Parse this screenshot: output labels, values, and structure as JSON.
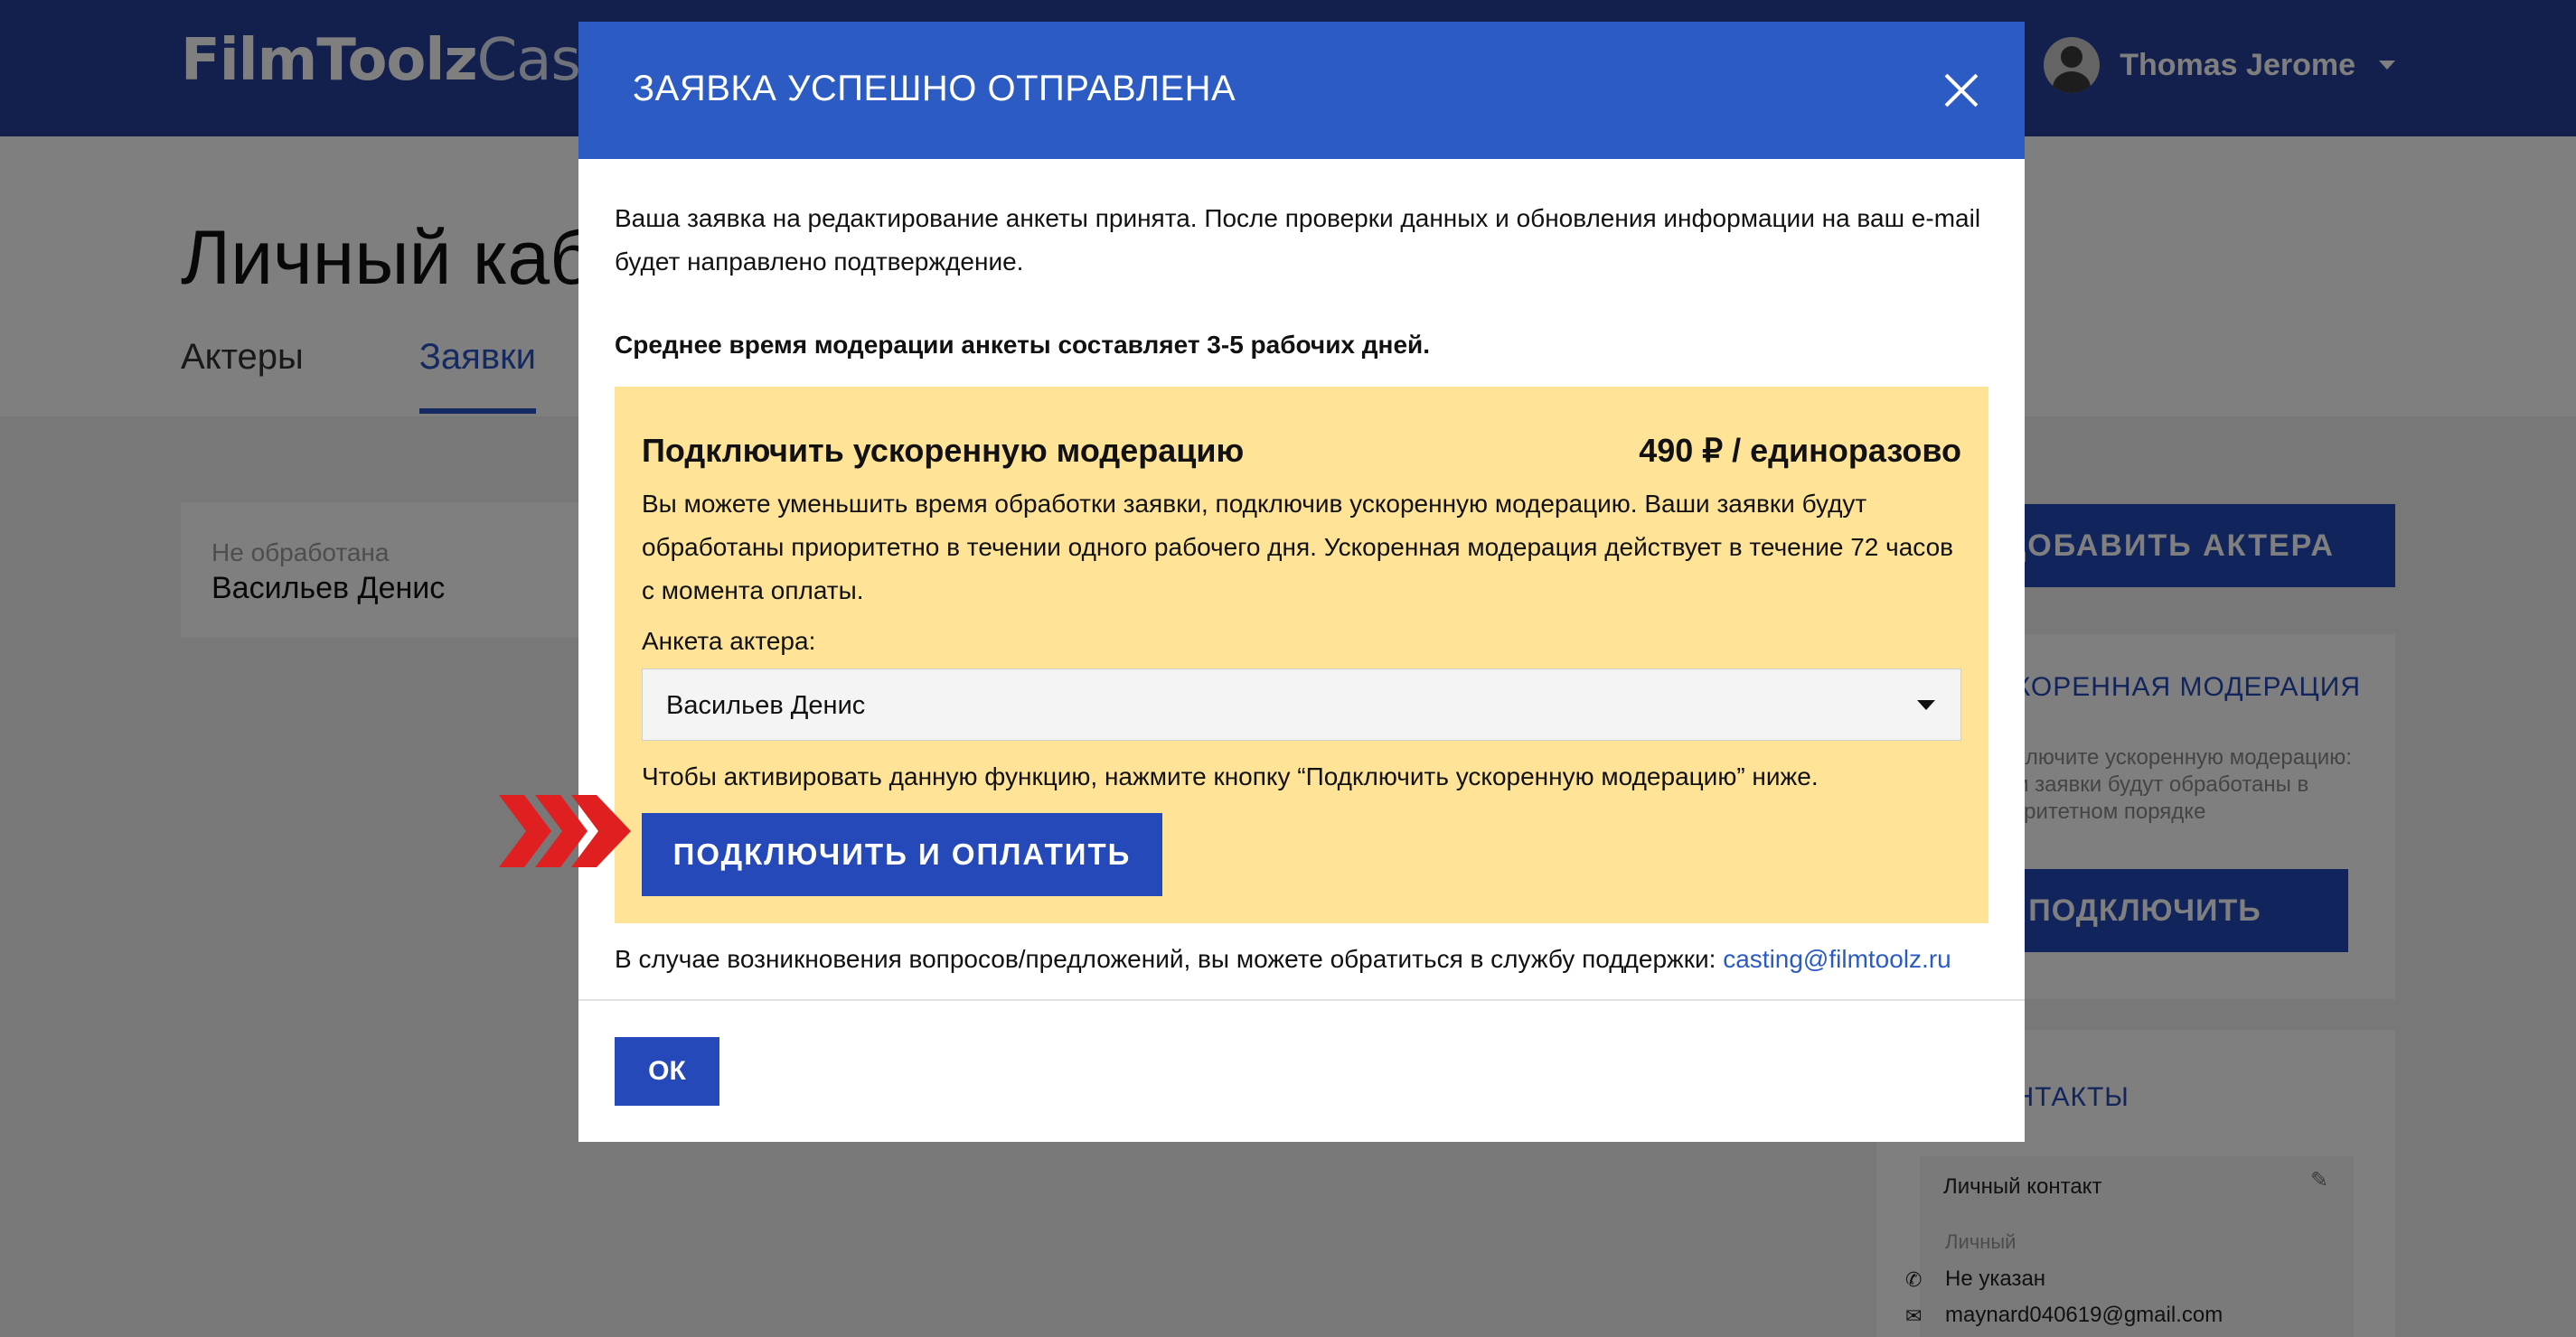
{
  "app": {
    "logo_bold": "FilmToolz",
    "logo_light": "Casting",
    "user_name": "Thomas Jerome"
  },
  "page": {
    "title": "Личный кабинет",
    "tabs": [
      {
        "label": "Актеры",
        "active": false
      },
      {
        "label": "Заявки",
        "active": true
      }
    ],
    "request": {
      "status": "Не обработана",
      "name": "Васильев Денис"
    }
  },
  "sidebar": {
    "add_actor_label": "ДОБАВИТЬ АКТЕРА",
    "moderation_card": {
      "title": "УСКОРЕННАЯ МОДЕРАЦИЯ",
      "text": "Подключите ускоренную модерацию: ваши заявки будут обработаны в приоритетном порядке",
      "button_label": "ПОДКЛЮЧИТЬ"
    },
    "contacts_card": {
      "title": "КОНТАКТЫ",
      "contact_title": "Личный контакт",
      "contact_kind": "Личный",
      "phone": "Не указан",
      "email": "maynard040619@gmail.com"
    }
  },
  "modal": {
    "title": "ЗАЯВКА УСПЕШНО ОТПРАВЛЕНА",
    "intro": "Ваша заявка на редактирование анкеты принята. После проверки данных и обновления информации на ваш e-mail будет направлено подтверждение.",
    "note": "Среднее время модерации анкеты составляет 3-5 рабочих дней.",
    "promo": {
      "title": "Подключить ускоренную модерацию",
      "price": "490 ₽ / единоразово",
      "description": "Вы можете уменьшить время обработки заявки, подключив ускоренную модерацию. Ваши заявки будут обработаны приоритетно в течении одного рабочего дня. Ускоренная модерация действует в течение 72 часов с момента оплаты.",
      "select_label": "Анкета актера:",
      "select_value": "Васильев Денис",
      "hint": "Чтобы активировать данную функцию, нажмите кнопку “Подключить ускоренную модерацию” ниже.",
      "button_label": "ПОДКЛЮЧИТЬ И ОПЛАТИТЬ"
    },
    "support_text": "В случае возникновения вопросов/предложений, вы можете обратиться в службу поддержки:",
    "support_email": "casting@filmtoolz.ru",
    "ok_label": "ОК"
  },
  "colors": {
    "brand_blue": "#2549b8",
    "header_blue": "#2c5bc4",
    "promo_yellow": "#ffe497",
    "arrow_red": "#e02020"
  }
}
